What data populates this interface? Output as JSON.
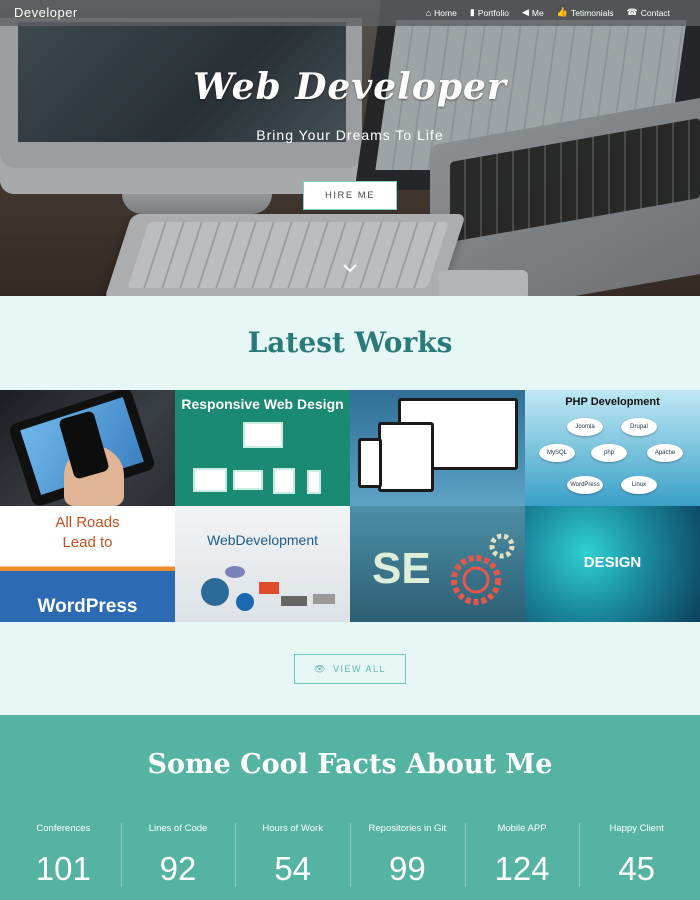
{
  "brand": "Developer",
  "nav": [
    {
      "icon": "home-icon",
      "label": "Home"
    },
    {
      "icon": "bookmark-icon",
      "label": "Portfolio"
    },
    {
      "icon": "megaphone-icon",
      "label": "Me"
    },
    {
      "icon": "thumbs-up-icon",
      "label": "Tetimonials"
    },
    {
      "icon": "phone-square-icon",
      "label": "Contact"
    }
  ],
  "hero": {
    "title": "Web Developer",
    "subtitle": "Bring Your Dreams To Life",
    "hire_button": "HIRE ME"
  },
  "works": {
    "title": "Latest Works",
    "tiles": [
      {
        "name": "tablet-phone"
      },
      {
        "name": "responsive-web-design",
        "label": "Responsive Web Design"
      },
      {
        "name": "multi-device"
      },
      {
        "name": "php-development",
        "label": "PHP Development",
        "badges": [
          "Joomla",
          "Drupal",
          "MySQL",
          "php",
          "Apache",
          "WordPress",
          "Linux"
        ]
      },
      {
        "name": "wordpress",
        "label_lines": [
          "All Roads",
          "Lead to",
          "WordPress"
        ]
      },
      {
        "name": "web-development",
        "label": "WebDevelopment"
      },
      {
        "name": "seo",
        "label": "SE"
      },
      {
        "name": "design",
        "label": "DESIGN"
      }
    ],
    "view_all": "VIEW ALL"
  },
  "facts": {
    "title": "Some Cool Facts About Me",
    "items": [
      {
        "label": "Conferences",
        "value": "101"
      },
      {
        "label": "Lines of Code",
        "value": "92"
      },
      {
        "label": "Hours of Work",
        "value": "54"
      },
      {
        "label": "Repositories in Git",
        "value": "99"
      },
      {
        "label": "Mobile APP",
        "value": "124"
      },
      {
        "label": "Happy Client",
        "value": "45"
      }
    ]
  },
  "colors": {
    "accent": "#55b3a2",
    "heading": "#2a7a7a",
    "page_bg": "#e6f7f6"
  }
}
